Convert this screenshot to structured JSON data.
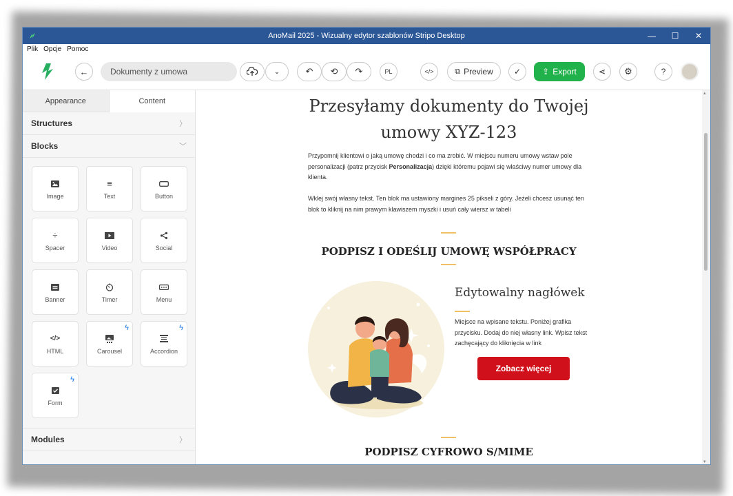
{
  "window": {
    "title": "AnoMail 2025 - Wizualny edytor szablonów Stripo Desktop",
    "controls": [
      "—",
      "☐",
      "✕"
    ]
  },
  "menu": [
    "Plik",
    "Opcje",
    "Pomoc"
  ],
  "toolbar": {
    "doc_name": "Dokumenty z umowa",
    "lang": "PL",
    "code": "</>",
    "preview": "Preview",
    "export": "Export",
    "help": "?"
  },
  "sidebar": {
    "tabs": [
      "Appearance",
      "Content"
    ],
    "active_tab": "Content",
    "structures": "Structures",
    "blocks_title": "Blocks",
    "modules": "Modules",
    "blocks": [
      {
        "label": "Image",
        "icon": "image-icon",
        "bolt": false
      },
      {
        "label": "Text",
        "icon": "text-icon",
        "bolt": false
      },
      {
        "label": "Button",
        "icon": "button-icon",
        "bolt": false
      },
      {
        "label": "Spacer",
        "icon": "spacer-icon",
        "bolt": false
      },
      {
        "label": "Video",
        "icon": "video-icon",
        "bolt": false
      },
      {
        "label": "Social",
        "icon": "social-icon",
        "bolt": false
      },
      {
        "label": "Banner",
        "icon": "banner-icon",
        "bolt": false
      },
      {
        "label": "Timer",
        "icon": "timer-icon",
        "bolt": false
      },
      {
        "label": "Menu",
        "icon": "menu-icon",
        "bolt": false
      },
      {
        "label": "HTML",
        "icon": "html-icon",
        "bolt": false
      },
      {
        "label": "Carousel",
        "icon": "carousel-icon",
        "bolt": true
      },
      {
        "label": "Accordion",
        "icon": "accordion-icon",
        "bolt": true
      },
      {
        "label": "Form",
        "icon": "form-icon",
        "bolt": true
      }
    ]
  },
  "email": {
    "heading_line1": "Przesyłamy dokumenty do Twojej",
    "heading_line2": "umowy XYZ-123",
    "intro_p1_a": "Przypomnij klientowi o jaką umowę chodzi i co ma zrobić. W miejscu numeru umowy wstaw pole personalizacji (patrz przycisk ",
    "intro_p1_bold": "Personalizacja",
    "intro_p1_b": ") dzięki któremu pojawi się właściwy numer umowy dla klienta.",
    "intro_p2": "Wklej swój własny tekst. Ten blok ma ustawiony margines 25 pikseli z góry. Jeżeli chcesz usunąć ten blok to kliknij na nim prawym klawiszem myszki i usuń cały wiersz w tabeli",
    "section1_title": "PODPISZ I ODEŚLIJ UMOWĘ WSPÓŁPRACY",
    "card_title": "Edytowalny nagłówek",
    "card_text": "Miejsce na wpisane tekstu. Poniżej grafika przycisku. Dodaj do niej własny link. Wpisz tekst zachęcający do kliknięcia w link",
    "cta": "Zobacz więcej",
    "section2_title": "PODPISZ CYFROWO S/MIME"
  },
  "colors": {
    "titlebar": "#2b5797",
    "export": "#22b24c",
    "cta": "#d0111b",
    "accent_line": "#f0c066",
    "bolt": "#1a73e8"
  }
}
